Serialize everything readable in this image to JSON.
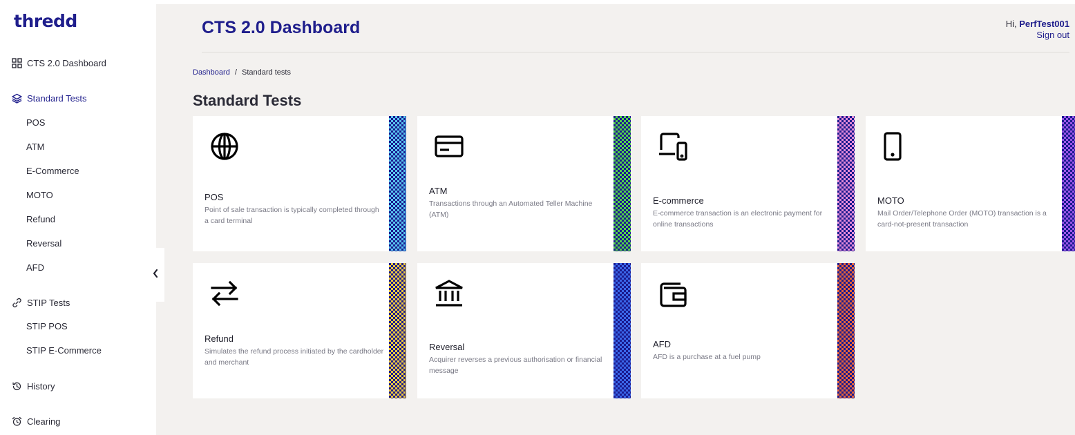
{
  "brand": {
    "logo": "thredd"
  },
  "sidebar": {
    "dashboard": "CTS 2.0 Dashboard",
    "standard_tests": "Standard Tests",
    "standard_sub": [
      "POS",
      "ATM",
      "E-Commerce",
      "MOTO",
      "Refund",
      "Reversal",
      "AFD"
    ],
    "stip_tests": "STIP Tests",
    "stip_sub": [
      "STIP POS",
      "STIP E-Commerce"
    ],
    "history": "History",
    "clearing": "Clearing"
  },
  "header": {
    "title": "CTS 2.0 Dashboard",
    "greeting": "Hi, ",
    "username": "PerfTest001",
    "signout": "Sign out"
  },
  "breadcrumb": {
    "home": "Dashboard",
    "separator": "/",
    "current": "Standard tests"
  },
  "section_title": "Standard Tests",
  "cards": [
    {
      "title": "POS",
      "desc": "Point of sale transaction is typically completed through a card terminal",
      "icon": "globe-icon",
      "stripe_colors": [
        "#1b1b8f",
        "#58c6f0"
      ]
    },
    {
      "title": "ATM",
      "desc": "Transactions through an Automated Teller Machine (ATM)",
      "icon": "card-icon",
      "stripe_colors": [
        "#1b1b8f",
        "#54d04a"
      ]
    },
    {
      "title": "E-commerce",
      "desc": "E-commerce transaction is an electronic payment for online transactions",
      "icon": "laptop-phone-icon",
      "stripe_colors": [
        "#1b1b8f",
        "#e48ad8"
      ]
    },
    {
      "title": "MOTO",
      "desc": "Mail Order/Telephone Order (MOTO) transaction is a card-not-present transaction",
      "icon": "mobile-icon",
      "stripe_colors": [
        "#1b1b8f",
        "#9a55e8"
      ]
    },
    {
      "title": "Refund",
      "desc": "Simulates the refund process initiated by the cardholder and merchant",
      "icon": "arrows-swap-icon",
      "stripe_colors": [
        "#1b1b8f",
        "#f2cc3c"
      ]
    },
    {
      "title": "Reversal",
      "desc": "Acquirer reverses a previous authorisation or financial message",
      "icon": "bank-icon",
      "stripe_colors": [
        "#1b1b8f",
        "#3a66e8"
      ]
    },
    {
      "title": "AFD",
      "desc": "AFD is a purchase at a fuel pump",
      "icon": "wallet-icon",
      "stripe_colors": [
        "#1b1b8f",
        "#e8643a"
      ]
    }
  ]
}
